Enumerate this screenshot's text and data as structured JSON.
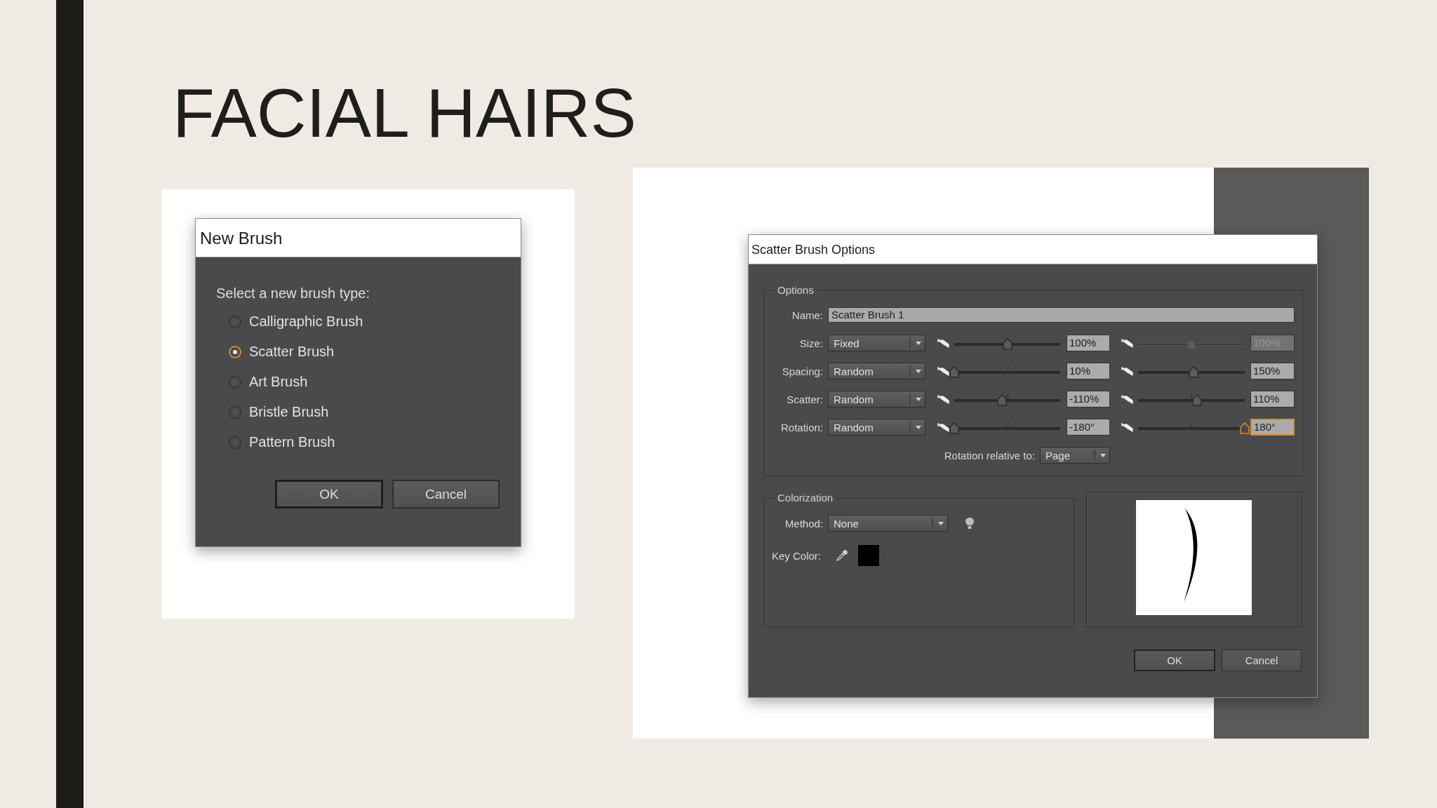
{
  "slide": {
    "title": "FACIAL HAIRS"
  },
  "new_brush_dialog": {
    "title": "New Brush",
    "prompt": "Select a new brush type:",
    "options": [
      {
        "label": "Calligraphic Brush",
        "selected": false
      },
      {
        "label": "Scatter Brush",
        "selected": true
      },
      {
        "label": "Art Brush",
        "selected": false
      },
      {
        "label": "Bristle Brush",
        "selected": false
      },
      {
        "label": "Pattern Brush",
        "selected": false
      }
    ],
    "buttons": [
      {
        "label": "OK",
        "default": true
      },
      {
        "label": "Cancel",
        "default": false
      }
    ]
  },
  "scatter_brush_dialog": {
    "title": "Scatter Brush Options",
    "options_group": {
      "title": "Options",
      "name_label": "Name:",
      "name_value": "Scatter Brush 1",
      "rows": [
        {
          "label": "Size:",
          "mode": "Fixed",
          "min": {
            "level": 0.5,
            "value": "100%"
          },
          "max": {
            "level": 0.5,
            "value": "100%",
            "disabled": true,
            "focused": false
          }
        },
        {
          "label": "Spacing:",
          "mode": "Random",
          "min": {
            "level": 0,
            "value": "10%"
          },
          "max": {
            "level": 0.52,
            "value": "150%",
            "disabled": false,
            "focused": false
          }
        },
        {
          "label": "Scatter:",
          "mode": "Random",
          "min": {
            "level": 0.45,
            "value": "-110%"
          },
          "max": {
            "level": 0.55,
            "value": "110%",
            "disabled": false,
            "focused": false
          }
        },
        {
          "label": "Rotation:",
          "mode": "Random",
          "min": {
            "level": 0,
            "value": "-180°"
          },
          "max": {
            "level": 1,
            "value": "180°",
            "disabled": false,
            "focused": true
          }
        }
      ],
      "rotation_relative": {
        "label": "Rotation relative to:",
        "value": "Page"
      }
    },
    "colorization_group": {
      "title": "Colorization",
      "method_label": "Method:",
      "method": "None",
      "key_color_label": "Key Color:"
    },
    "buttons": [
      {
        "label": "OK",
        "default": true
      },
      {
        "label": "Cancel",
        "default": false
      }
    ]
  }
}
